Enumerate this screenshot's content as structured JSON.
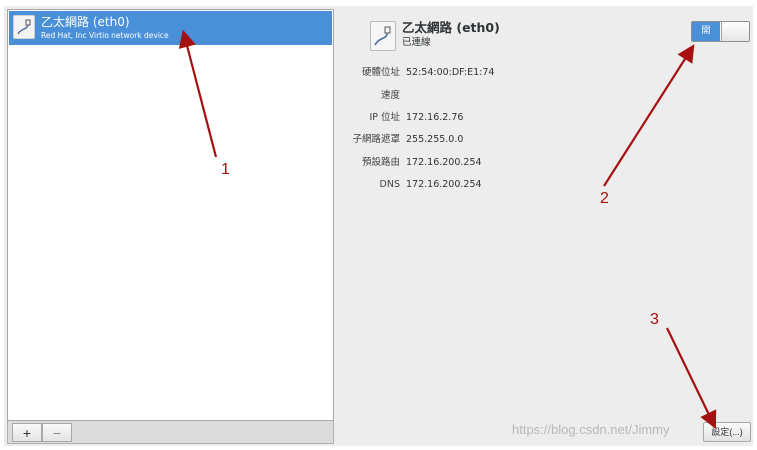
{
  "device_list": {
    "items": [
      {
        "name": "乙太網路 (eth0)",
        "description": "Red Hat, Inc Virtio network device",
        "icon": "ethernet-icon",
        "selected": true
      }
    ],
    "toolbar": {
      "add_label": "+",
      "remove_label": "−"
    }
  },
  "details": {
    "title": "乙太網路 (eth0)",
    "status": "已連線",
    "icon": "ethernet-icon",
    "rows": [
      {
        "label": "硬體位址",
        "value": "52:54:00:DF:E1:74"
      },
      {
        "label": "速度",
        "value": ""
      },
      {
        "label": "IP 位址",
        "value": "172.16.2.76"
      },
      {
        "label": "子網路遮罩",
        "value": "255.255.0.0"
      },
      {
        "label": "預設路由",
        "value": "172.16.200.254"
      },
      {
        "label": "DNS",
        "value": "172.16.200.254"
      }
    ],
    "switch": {
      "on_label": "開",
      "state": "on"
    },
    "settings_label": "設定(...)"
  },
  "annotations": {
    "labels": [
      "1",
      "2",
      "3"
    ],
    "color": "#a51010"
  },
  "watermark": "https://blog.csdn.net/Jimmy",
  "colors": {
    "selection": "#4a90d9",
    "window_bg": "#ededed",
    "annotation": "#a51010"
  }
}
